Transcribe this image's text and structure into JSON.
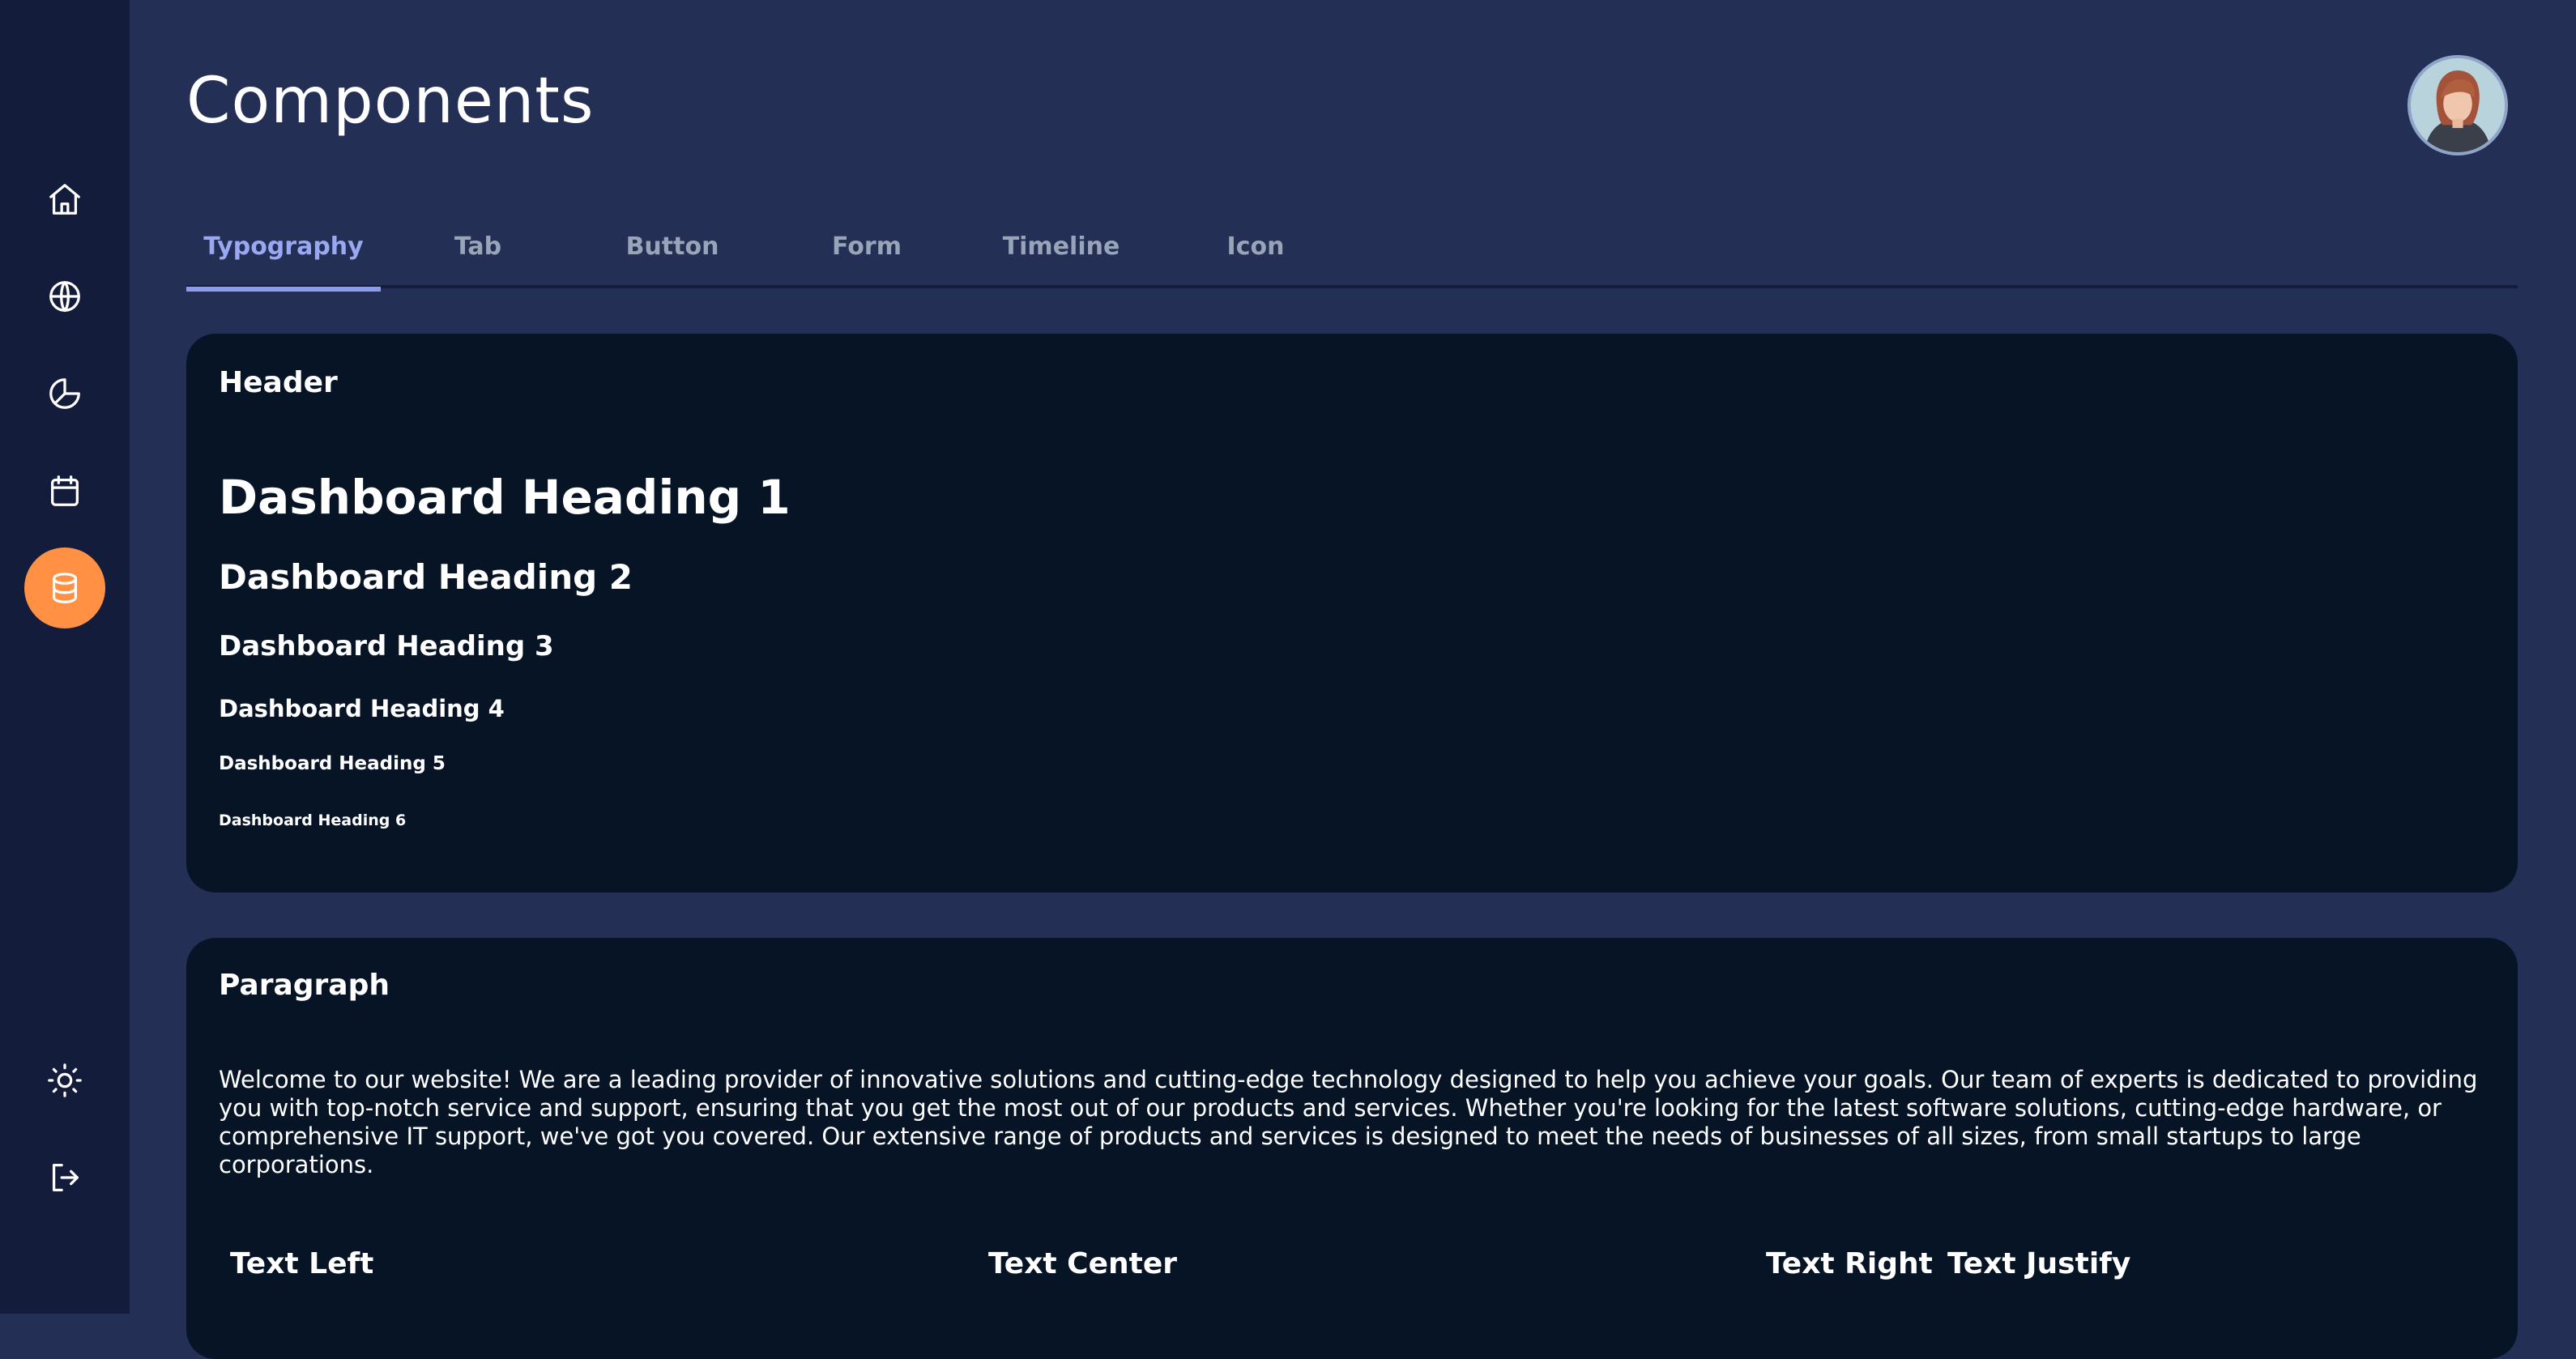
{
  "page": {
    "title": "Components"
  },
  "sidebar": {
    "items": [
      {
        "icon": "home-icon"
      },
      {
        "icon": "globe-icon"
      },
      {
        "icon": "pie-chart-icon"
      },
      {
        "icon": "calendar-icon"
      },
      {
        "icon": "database-icon",
        "active": true
      },
      {
        "icon": "sun-icon"
      },
      {
        "icon": "logout-icon"
      }
    ],
    "active_color": "#ff9044"
  },
  "tabs": [
    {
      "label": "Typography",
      "active": true
    },
    {
      "label": "Tab"
    },
    {
      "label": "Button"
    },
    {
      "label": "Form"
    },
    {
      "label": "Timeline"
    },
    {
      "label": "Icon"
    }
  ],
  "header_card": {
    "title": "Header",
    "headings": [
      "Dashboard Heading 1",
      "Dashboard Heading 2",
      "Dashboard Heading 3",
      "Dashboard Heading 4",
      "Dashboard Heading 5",
      "Dashboard Heading 6"
    ]
  },
  "paragraph_card": {
    "title": "Paragraph",
    "text": "Welcome to our website! We are a leading provider of innovative solutions and cutting-edge technology designed to help you achieve your goals. Our team of experts is dedicated to providing you with top-notch service and support, ensuring that you get the most out of our products and services. Whether you're looking for the latest software solutions, cutting-edge hardware, or comprehensive IT support, we've got you covered. Our extensive range of products and services is designed to meet the needs of businesses of all sizes, from small startups to large corporations.",
    "alignments": [
      {
        "title": "Text Left"
      },
      {
        "title": "Text Center"
      },
      {
        "title": "Text Right"
      },
      {
        "title": "Text Justify"
      }
    ]
  }
}
